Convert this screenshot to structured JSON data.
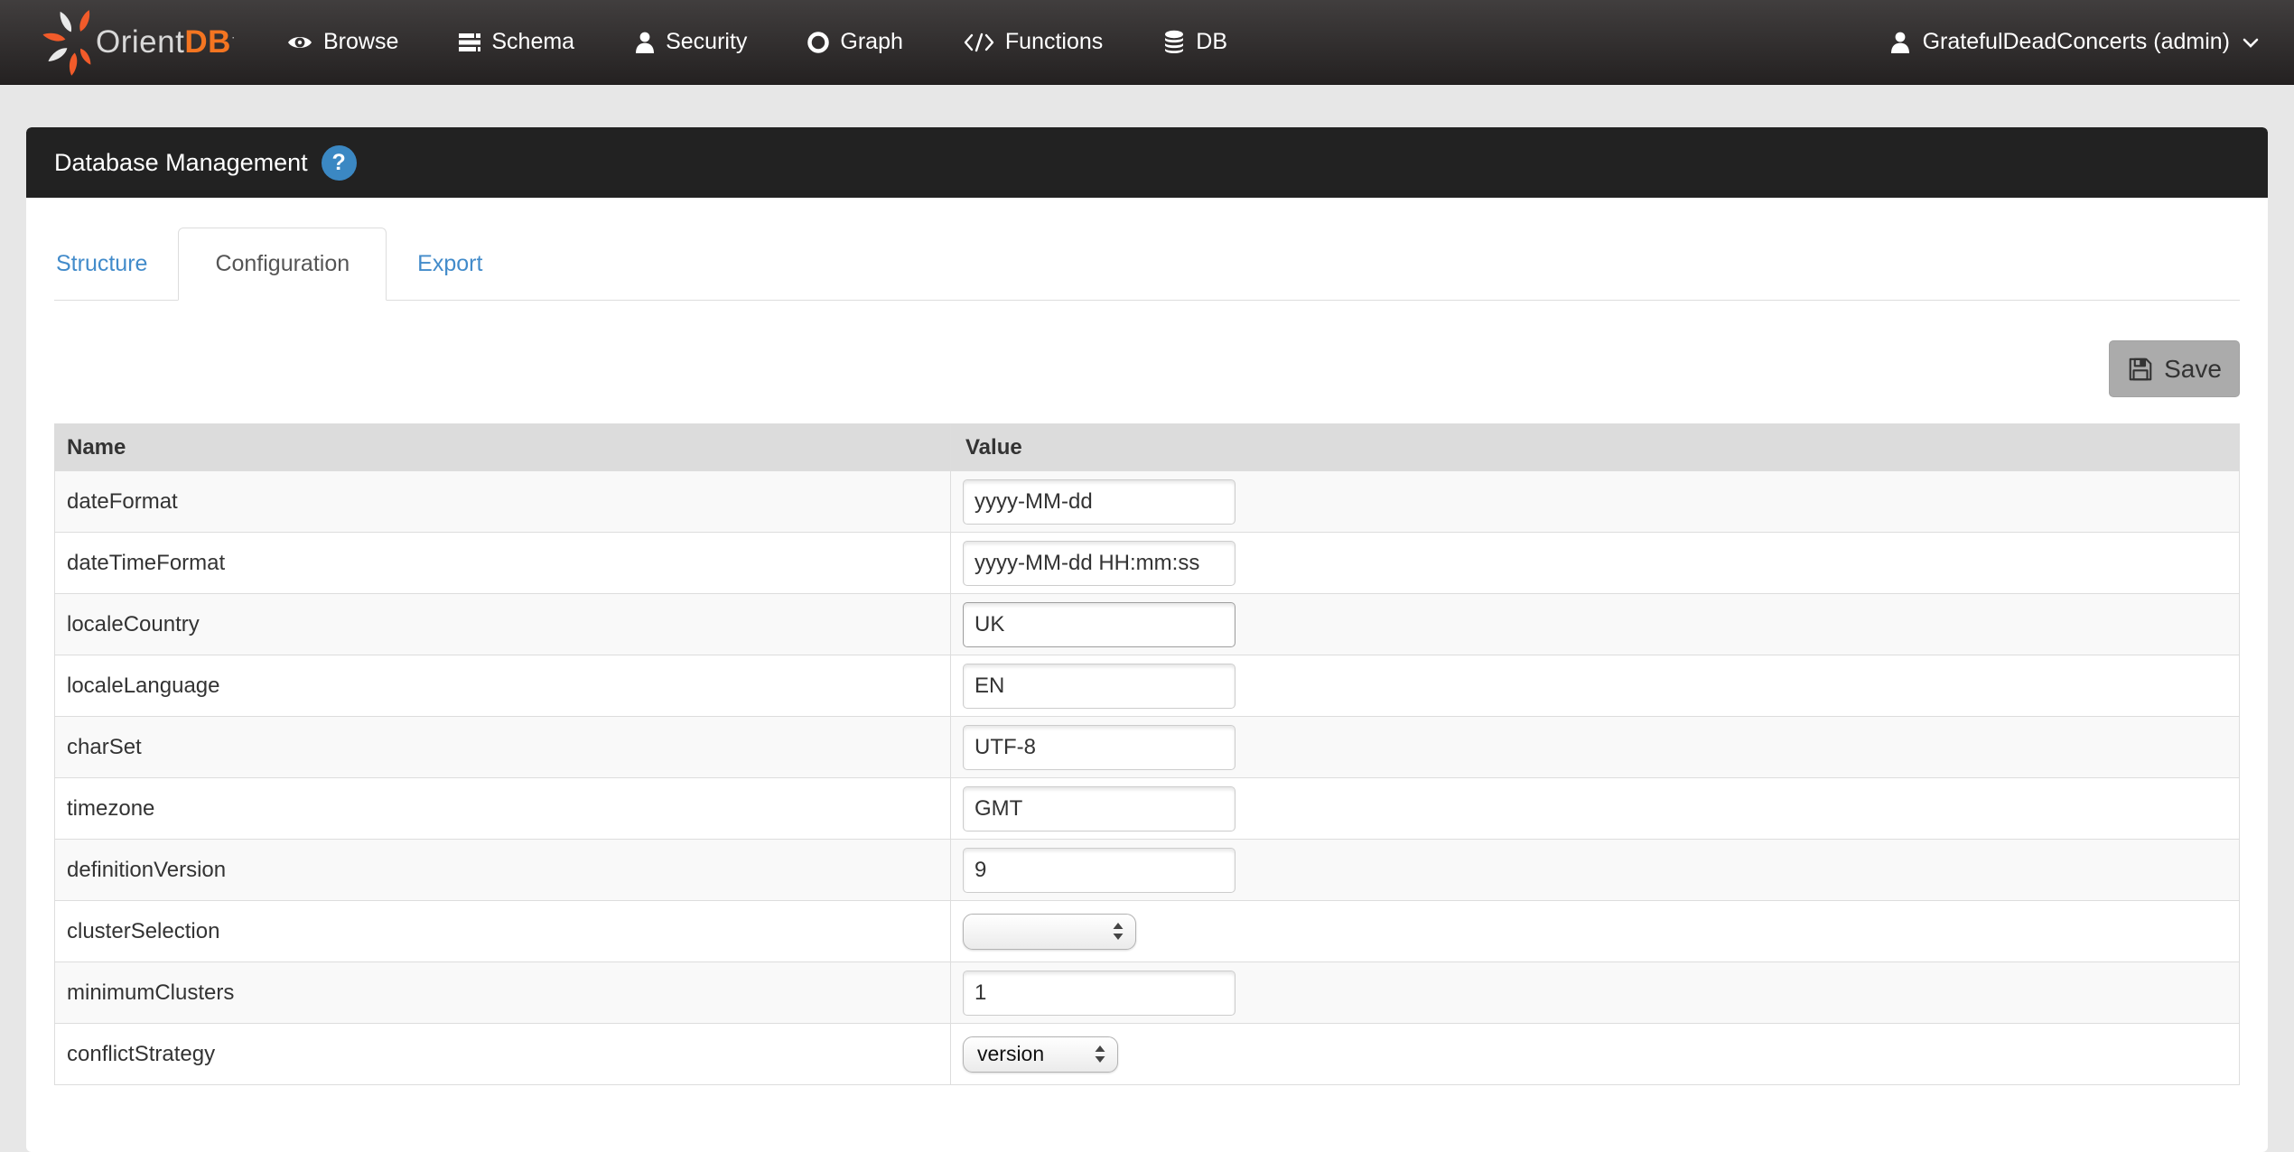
{
  "colors": {
    "brand_orange": "#f47521",
    "link_blue": "#428bca",
    "help_blue": "#3b88c3",
    "navbar_dark": "#2e2b2b",
    "panel_header_dark": "#222222",
    "table_header_bg": "#dcdcdc",
    "striped_row_bg": "#f9f9f9",
    "save_button_bg": "#ababab"
  },
  "navbar": {
    "brand": {
      "orient": "Orient",
      "db": "DB"
    },
    "items": [
      {
        "label": "Browse",
        "icon": "eye-icon"
      },
      {
        "label": "Schema",
        "icon": "tasks-icon"
      },
      {
        "label": "Security",
        "icon": "user-icon"
      },
      {
        "label": "Graph",
        "icon": "circle-icon"
      },
      {
        "label": "Functions",
        "icon": "code-icon"
      },
      {
        "label": "DB",
        "icon": "database-icon"
      }
    ],
    "user": {
      "label": "GratefulDeadConcerts (admin)",
      "icon": "user-icon"
    }
  },
  "panel": {
    "title": "Database Management",
    "help_icon": "?",
    "tabs": [
      {
        "label": "Structure",
        "active": false
      },
      {
        "label": "Configuration",
        "active": true
      },
      {
        "label": "Export",
        "active": false
      }
    ],
    "save_label": "Save"
  },
  "table": {
    "headers": {
      "name": "Name",
      "value": "Value"
    },
    "rows": [
      {
        "name": "dateFormat",
        "control": "input",
        "value": "yyyy-MM-dd"
      },
      {
        "name": "dateTimeFormat",
        "control": "input",
        "value": "yyyy-MM-dd HH:mm:ss"
      },
      {
        "name": "localeCountry",
        "control": "input",
        "value": "UK",
        "focused": true
      },
      {
        "name": "localeLanguage",
        "control": "input",
        "value": "EN"
      },
      {
        "name": "charSet",
        "control": "input",
        "value": "UTF-8"
      },
      {
        "name": "timezone",
        "control": "input",
        "value": "GMT"
      },
      {
        "name": "definitionVersion",
        "control": "input",
        "value": "9"
      },
      {
        "name": "clusterSelection",
        "control": "select",
        "value": ""
      },
      {
        "name": "minimumClusters",
        "control": "input",
        "value": "1"
      },
      {
        "name": "conflictStrategy",
        "control": "select",
        "value": "version"
      }
    ]
  }
}
